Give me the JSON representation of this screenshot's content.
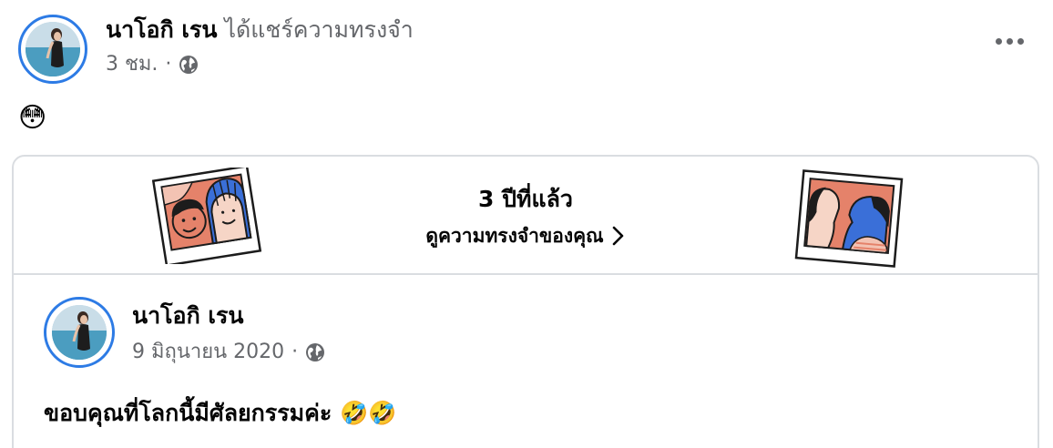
{
  "post": {
    "author_name": "นาโอกิ เรน",
    "action_text": "ได้แชร์ความทรงจำ",
    "time": "3 ชม.",
    "separator": "·",
    "privacy_icon": "globe-icon",
    "text": "😳"
  },
  "memory": {
    "years_ago": "3 ปีที่แล้ว",
    "see_memories": "ดูความทรงจำของคุณ",
    "chevron_icon": "chevron-right-icon"
  },
  "original_post": {
    "author_name": "นาโอกิ เรน",
    "date": "9 มิถุนายน 2020",
    "separator": "·",
    "privacy_icon": "globe-icon",
    "text": "ขอบคุณที่โลกนี้มีศัลยกรรมค่ะ 🤣🤣"
  },
  "colors": {
    "story_ring": "#2d7be5",
    "secondary_text": "#65676b",
    "border": "#dadde1"
  }
}
